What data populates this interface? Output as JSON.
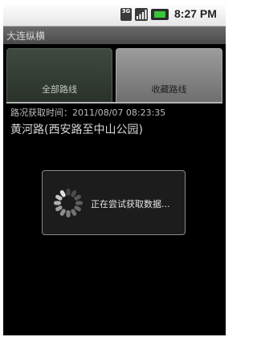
{
  "status_bar": {
    "network_badge": "3G",
    "time": "8:27 PM",
    "icons": [
      "3g-icon",
      "signal-icon",
      "battery-icon"
    ]
  },
  "app": {
    "title": "大连纵横"
  },
  "tabs": [
    {
      "label": "全部路线",
      "selected": false
    },
    {
      "label": "收藏路线",
      "selected": true
    }
  ],
  "content": {
    "update_time": "路况获取时间：2011/08/07 08:23:35",
    "road_name": "黄河路(西安路至中山公园)"
  },
  "dialog": {
    "message": "正在尝试获取数据..."
  },
  "colors": {
    "background": "#000000",
    "selected_tab": "#8a8a8a",
    "unselected_tab": "#2e362e",
    "battery": "#39c43a"
  }
}
